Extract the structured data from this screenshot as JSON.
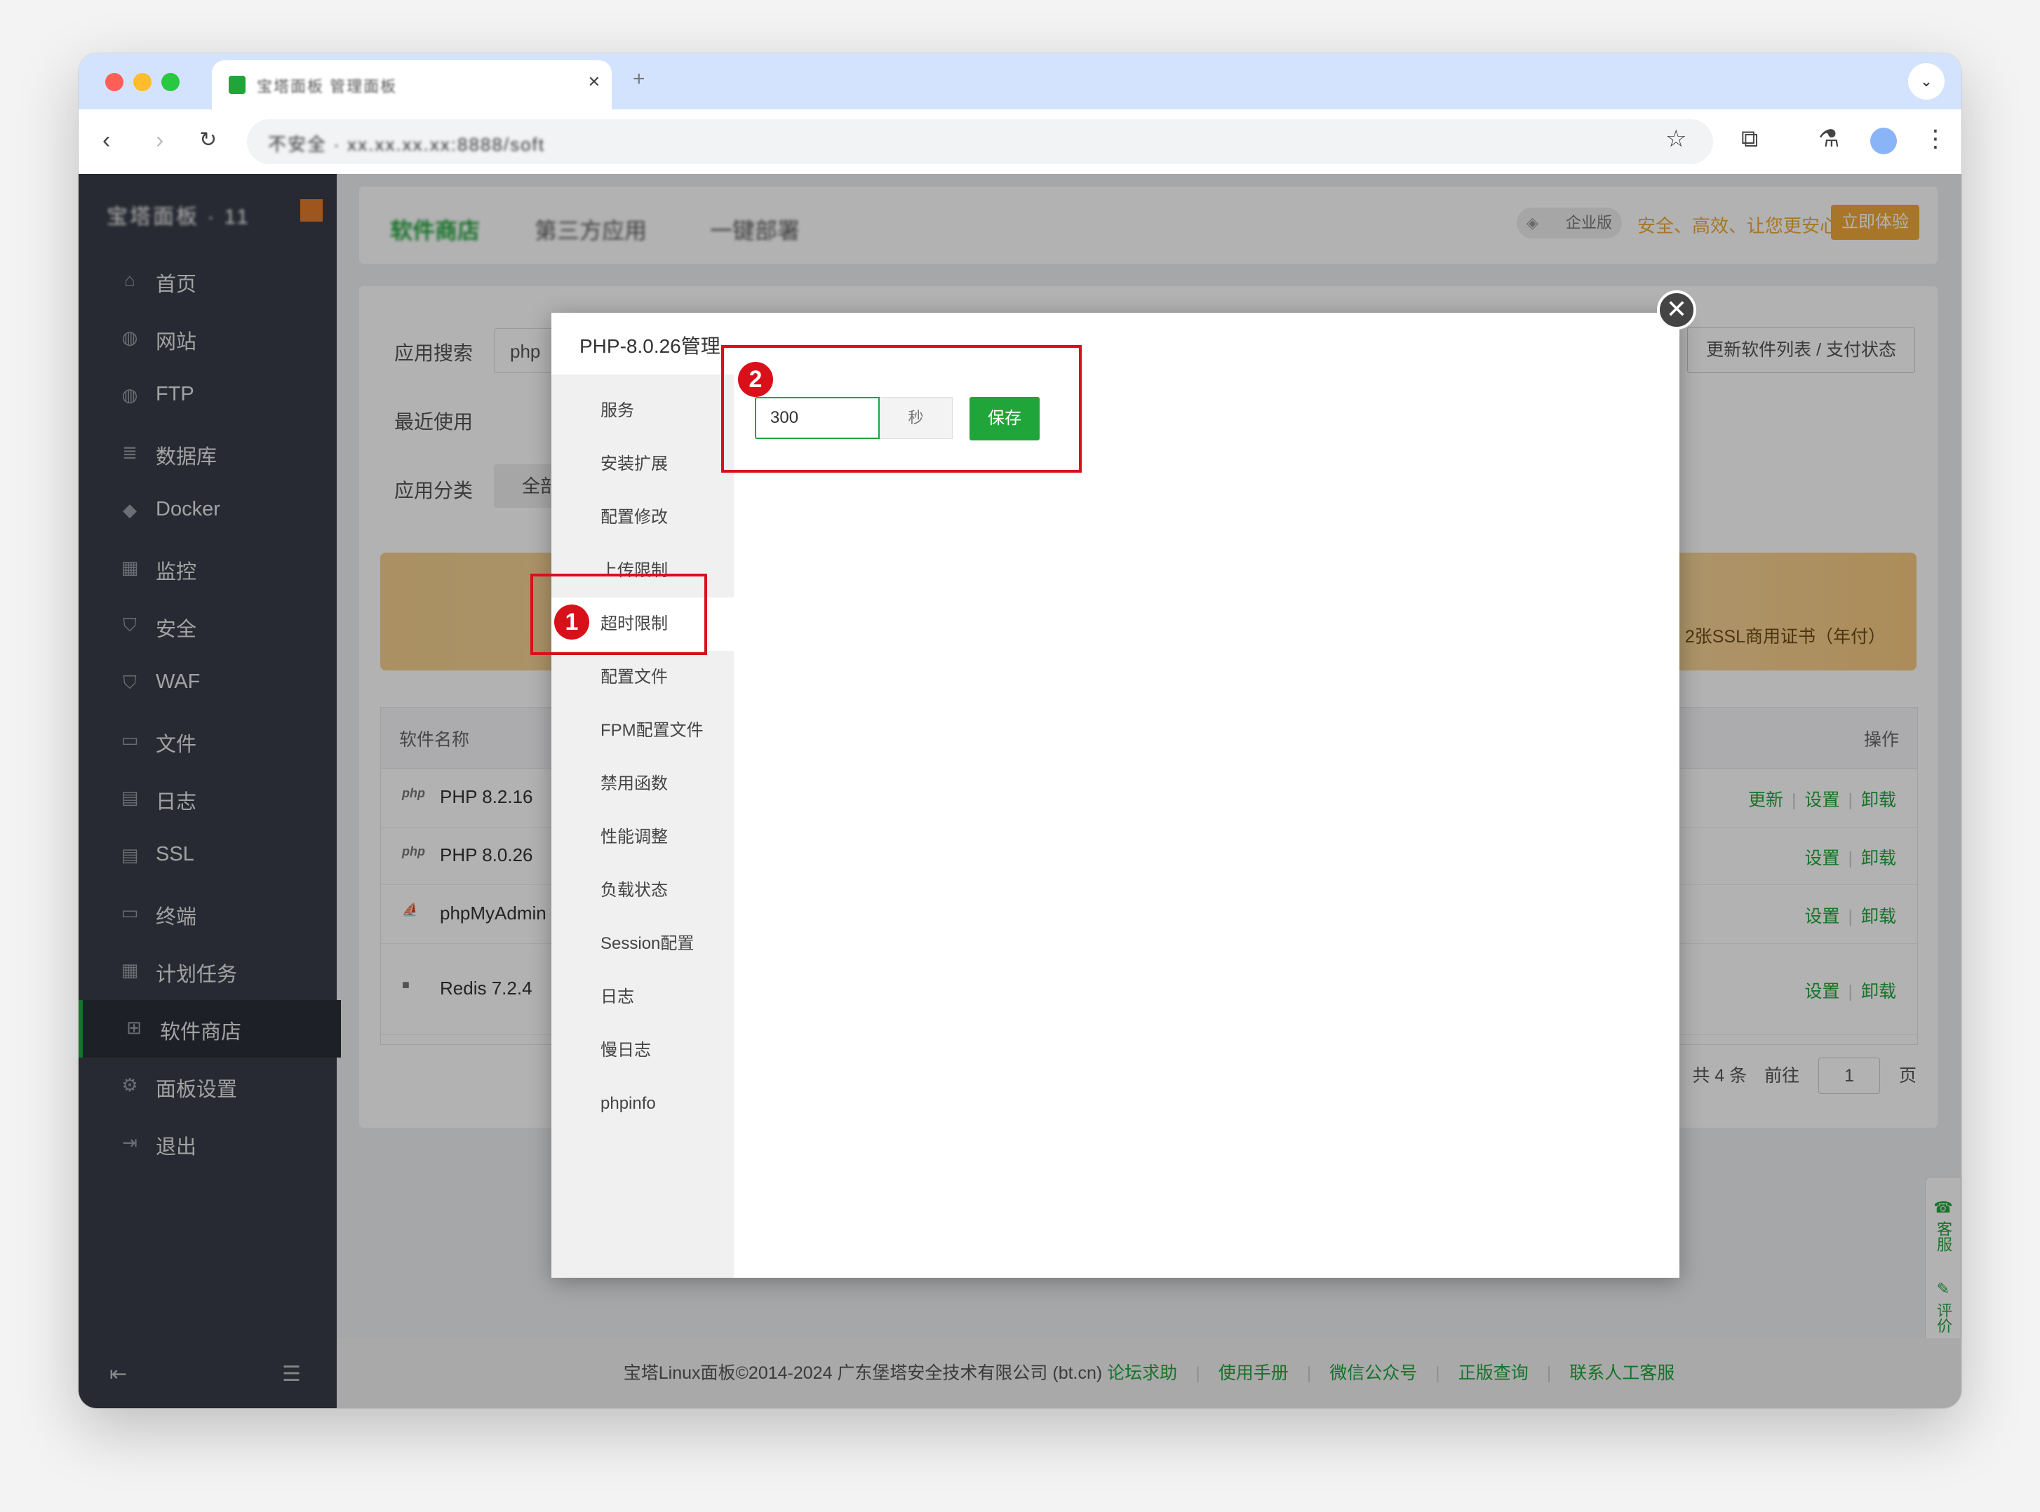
{
  "browser": {
    "tab_title": "宝塔面板 管理面板",
    "url": "不安全 · xx.xx.xx.xx:8888/soft"
  },
  "sidebar": {
    "brand": "宝塔面板 · 11",
    "items": [
      {
        "label": "首页",
        "icon": "home-icon"
      },
      {
        "label": "网站",
        "icon": "globe-icon"
      },
      {
        "label": "FTP",
        "icon": "ftp-icon"
      },
      {
        "label": "数据库",
        "icon": "database-icon"
      },
      {
        "label": "Docker",
        "icon": "docker-icon"
      },
      {
        "label": "监控",
        "icon": "monitor-icon"
      },
      {
        "label": "安全",
        "icon": "shield-icon"
      },
      {
        "label": "WAF",
        "icon": "waf-icon"
      },
      {
        "label": "文件",
        "icon": "folder-icon"
      },
      {
        "label": "日志",
        "icon": "log-icon"
      },
      {
        "label": "SSL",
        "icon": "ssl-icon"
      },
      {
        "label": "终端",
        "icon": "terminal-icon"
      },
      {
        "label": "计划任务",
        "icon": "calendar-icon"
      },
      {
        "label": "软件商店",
        "icon": "grid-icon"
      },
      {
        "label": "面板设置",
        "icon": "gear-icon"
      },
      {
        "label": "退出",
        "icon": "logout-icon"
      }
    ]
  },
  "topnav": {
    "tab1": "软件商店",
    "tab2": "第三方应用",
    "tab3": "一键部署",
    "enterprise_badge": "企业版",
    "enterprise_slogan": "安全、高效、让您更安心",
    "enterprise_button": "立即体验"
  },
  "content": {
    "search_label": "应用搜索",
    "search_value": "php",
    "recent_label": "最近使用",
    "category_label": "应用分类",
    "category_value": "全部",
    "update_button": "更新软件列表 / 支付状态",
    "banner_text": "2张SSL商用证书（年付）",
    "table": {
      "col_name": "软件名称",
      "col_ops": "操作",
      "rows": [
        {
          "icon": "php",
          "name": "PHP 8.2.16",
          "ops": [
            "更新",
            "设置",
            "卸载"
          ]
        },
        {
          "icon": "php",
          "name": "PHP 8.0.26",
          "ops": [
            "设置",
            "卸载"
          ]
        },
        {
          "icon": "⛵",
          "name": "phpMyAdmin",
          "ops": [
            "设置",
            "卸载"
          ]
        },
        {
          "icon": "■",
          "name": "Redis 7.2.4",
          "ops": [
            "设置",
            "卸载"
          ]
        }
      ]
    },
    "pager": {
      "total": "共 4 条",
      "goto": "前往",
      "page": "1",
      "unit": "页"
    }
  },
  "float_panel": {
    "service": "客服",
    "review": "评价"
  },
  "footer": {
    "copyright": "宝塔Linux面板©2014-2024 广东堡塔安全技术有限公司 (bt.cn)",
    "links": [
      "论坛求助",
      "使用手册",
      "微信公众号",
      "正版查询",
      "联系人工客服"
    ]
  },
  "modal": {
    "title": "PHP-8.0.26管理",
    "menu": [
      "服务",
      "安装扩展",
      "配置修改",
      "上传限制",
      "超时限制",
      "配置文件",
      "FPM配置文件",
      "禁用函数",
      "性能调整",
      "负载状态",
      "Session配置",
      "日志",
      "慢日志",
      "phpinfo"
    ],
    "active_index": 4,
    "timeout_value": "300",
    "timeout_unit": "秒",
    "save_label": "保存"
  },
  "annotations": {
    "step1": "1",
    "step2": "2"
  },
  "colors": {
    "accent": "#20a53a",
    "annotation": "#d8101a",
    "sidebar": "#393d49"
  }
}
